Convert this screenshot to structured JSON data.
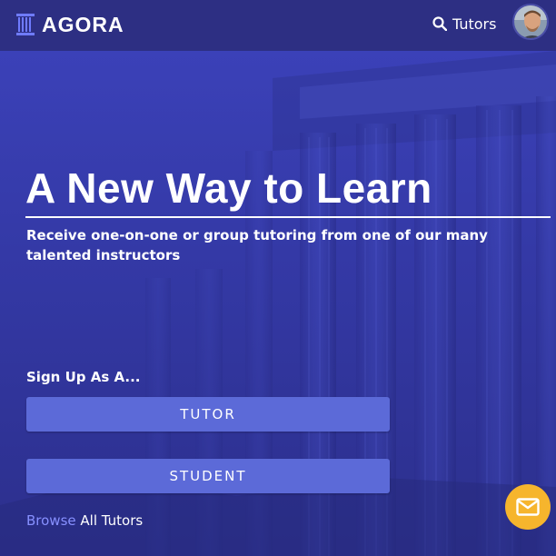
{
  "header": {
    "brand": "AGORA",
    "nav_tutors": "Tutors"
  },
  "hero": {
    "title": "A New Way to Learn",
    "subtitle": "Receive one-on-one or group tutoring from one of our many talented instructors",
    "signup_heading": "Sign Up As A...",
    "tutor_button": "TUTOR",
    "student_button": "STUDENT",
    "browse_link": "Browse",
    "browse_rest": "All Tutors"
  },
  "colors": {
    "header_bg": "#2d2f83",
    "hero_bg": "#3439a6",
    "button_bg": "#5c6ad8",
    "link": "#8790ff",
    "fab": "#f6b52d"
  },
  "icons": {
    "brand": "column-icon",
    "search": "search-icon",
    "fab": "mail-icon"
  }
}
